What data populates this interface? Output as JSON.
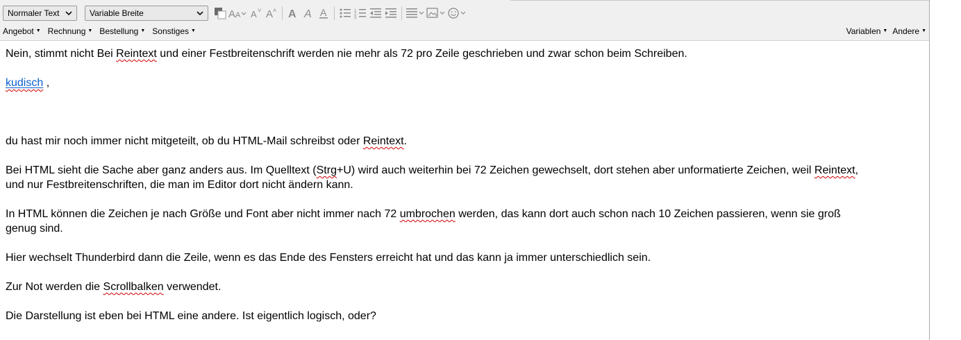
{
  "toolbar": {
    "paragraph_format": "Normaler Text",
    "font_family": "Variable Breite",
    "icons": [
      "text-color-icon",
      "smaller-font-icon",
      "font-size-down-icon",
      "font-size-up-icon",
      "bold-icon",
      "italic-icon",
      "underline-icon",
      "bullet-list-icon",
      "numbered-list-icon",
      "outdent-icon",
      "indent-icon",
      "align-icon",
      "insert-image-icon",
      "emoji-icon"
    ]
  },
  "menus": {
    "left": [
      "Angebot",
      "Rechnung",
      "Bestellung",
      "Sonstiges"
    ],
    "right": [
      "Variablen",
      "Andere"
    ]
  },
  "body": {
    "p1": "Nein, stimmt nicht Bei Reintext und einer Festbreitenschrift werden nie mehr als 72 pro Zeile geschrieben und zwar schon beim Schreiben.",
    "p1_a": "Nein, stimmt nicht Bei ",
    "p1_b": "Reintext",
    "p1_c": " und einer Festbreitenschrift werden nie mehr als 72 pro Zeile geschrieben und zwar schon beim Schreiben.",
    "mention_link": "kudisch",
    "mention_suffix": " ,",
    "p2_a": "du hast mir noch immer nicht mitgeteilt, ob du HTML-Mail schreibst oder ",
    "p2_b": "Reintext",
    "p2_c": ".",
    "p3_a": "Bei HTML sieht die Sache aber ganz anders aus. Im Quelltext (",
    "p3_b": "Strg",
    "p3_c": "+U) wird auch weiterhin bei 72 Zeichen gewechselt, dort stehen aber unformatierte Zeichen, weil ",
    "p3_d": "Reintext",
    "p3_e": ",",
    "p3_line2": "und nur Festbreitenschriften, die man im Editor dort nicht ändern kann.",
    "p4_a": "In HTML können die Zeichen je nach Größe und Font aber nicht immer nach 72 ",
    "p4_b": "umbrochen",
    "p4_c": " werden, das kann dort auch schon nach 10 Zeichen passieren, wenn sie groß",
    "p4_line2": "genug sind.",
    "p5": "Hier wechselt Thunderbird dann die Zeile, wenn es das Ende des Fensters erreicht hat und das kann ja immer unterschiedlich sein.",
    "p6_a": "Zur Not werden die ",
    "p6_b": "Scrollbalken",
    "p6_c": " verwendet.",
    "p7": "Die Darstellung ist eben bei HTML eine andere. Ist eigentlich logisch, oder?"
  },
  "colors": {
    "link": "#0b5fd1",
    "spellcheck": "#d10000",
    "toolbar_bg": "#f0f0f0"
  }
}
